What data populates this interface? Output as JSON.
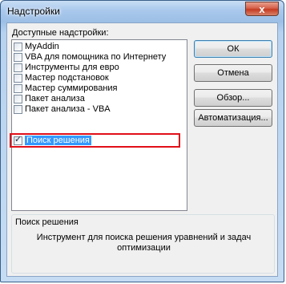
{
  "window": {
    "title": "Надстройки",
    "close_glyph": "x"
  },
  "addins": {
    "label": "Доступные надстройки:",
    "items": [
      {
        "label": "MyAddin",
        "checked": false
      },
      {
        "label": "VBA для помощника по Интернету",
        "checked": false
      },
      {
        "label": "Инструменты для евро",
        "checked": false
      },
      {
        "label": "Мастер подстановок",
        "checked": false
      },
      {
        "label": "Мастер суммирования",
        "checked": false
      },
      {
        "label": "Пакет анализа",
        "checked": false
      },
      {
        "label": "Пакет анализа - VBA",
        "checked": false
      },
      {
        "label": "Поиск решения",
        "checked": true,
        "selected": true
      }
    ]
  },
  "buttons": {
    "ok": "ОК",
    "cancel": "Отмена",
    "browse": "Обзор...",
    "automation": "Автоматизация..."
  },
  "description": {
    "title": "Поиск решения",
    "text": "Инструмент для поиска решения уравнений и задач оптимизации"
  },
  "colors": {
    "selection": "#3399ff",
    "highlight_frame": "#e0101a"
  }
}
